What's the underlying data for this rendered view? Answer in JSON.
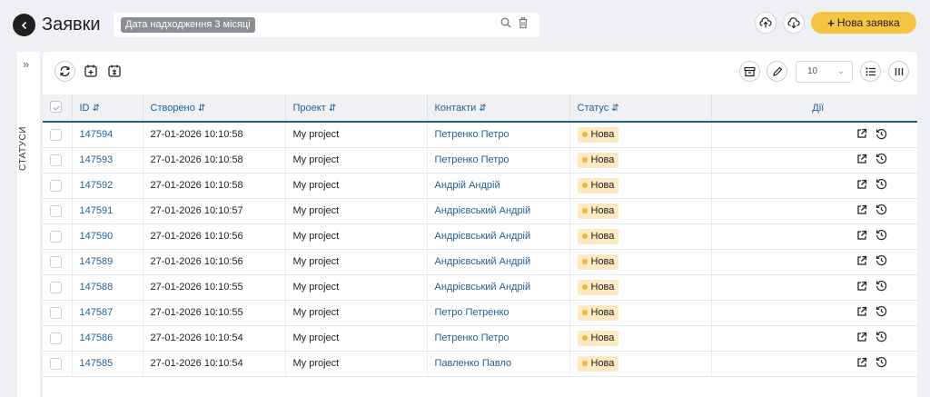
{
  "header": {
    "title": "Заявки",
    "filter_chip": "Дата надходження 3 місяці",
    "new_button": "Нова заявка"
  },
  "sidebar": {
    "label": "СТАТУСИ"
  },
  "toolbar": {
    "rows_per_page": "10"
  },
  "table": {
    "columns": {
      "id": "ID",
      "created": "Створено",
      "project": "Проект",
      "contacts": "Контакти",
      "status": "Статус",
      "actions": "Дії"
    },
    "rows": [
      {
        "id": "147594",
        "created": "27-01-2026 10:10:58",
        "project": "My project",
        "contact": "Петренко Петро",
        "status": "Нова"
      },
      {
        "id": "147593",
        "created": "27-01-2026 10:10:58",
        "project": "My project",
        "contact": "Петренко Петро",
        "status": "Нова"
      },
      {
        "id": "147592",
        "created": "27-01-2026 10:10:58",
        "project": "My project",
        "contact": "Андрій Андрій",
        "status": "Нова"
      },
      {
        "id": "147591",
        "created": "27-01-2026 10:10:57",
        "project": "My project",
        "contact": "Андрієвський Андрій",
        "status": "Нова"
      },
      {
        "id": "147590",
        "created": "27-01-2026 10:10:56",
        "project": "My project",
        "contact": "Андрієвський Андрій",
        "status": "Нова"
      },
      {
        "id": "147589",
        "created": "27-01-2026 10:10:56",
        "project": "My project",
        "contact": "Андрієвський Андрій",
        "status": "Нова"
      },
      {
        "id": "147588",
        "created": "27-01-2026 10:10:55",
        "project": "My project",
        "contact": "Андрієвський Андрій",
        "status": "Нова"
      },
      {
        "id": "147587",
        "created": "27-01-2026 10:10:55",
        "project": "My project",
        "contact": "Петро Петренко",
        "status": "Нова"
      },
      {
        "id": "147586",
        "created": "27-01-2026 10:10:54",
        "project": "My project",
        "contact": "Петренко Петро",
        "status": "Нова"
      },
      {
        "id": "147585",
        "created": "27-01-2026 10:10:54",
        "project": "My project",
        "contact": "Павленко Павло",
        "status": "Нова"
      }
    ]
  },
  "colors": {
    "accent": "#1f5f94",
    "new_button": "#f6c443",
    "status_new_bg": "#fde9c2"
  }
}
